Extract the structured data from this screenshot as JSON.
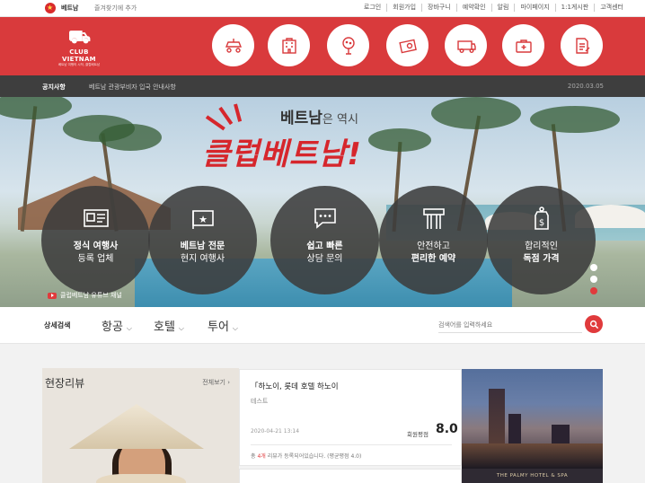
{
  "topbar": {
    "country": "베트남",
    "bookmark": "즐겨찾기에 추가",
    "links": [
      "로그인",
      "회원가입",
      "장바구니",
      "예약확인",
      "알림",
      "마이페이지",
      "1:1게시판",
      "고객센터"
    ]
  },
  "header": {
    "logo_text": "CLUB VIETNAM",
    "logo_sub": "베트남 여행의 시작, 클럽베트남",
    "category_icons": [
      "golf-cart-icon",
      "hotel-icon",
      "golf-icon",
      "ticket-icon",
      "transport-icon",
      "medical-icon",
      "document-icon"
    ]
  },
  "notice": {
    "label": "공지사항",
    "text": "베트남 관광부비자 입국 안내사항",
    "date": "2020.03.05"
  },
  "hero": {
    "slogan_small_highlight": "베트남",
    "slogan_small_rest": "은 역시",
    "slogan_big": "클럽베트남!",
    "features": [
      {
        "line1": "정식 여행사",
        "line2": "등록 업체",
        "icon": "id-card-icon"
      },
      {
        "line1": "베트남 전문",
        "line2": "현지 여행사",
        "icon": "vietnam-flag-icon"
      },
      {
        "line1": "쉽고 빠른",
        "line2": "상담 문의",
        "icon": "chat-icon"
      },
      {
        "line1": "안전하고",
        "line2": "편리한 예약",
        "icon": "card-icon"
      },
      {
        "line1": "합리적인",
        "line2": "독점 가격",
        "icon": "price-tag-icon"
      }
    ],
    "youtube_label": "클럽베트남 유튜브 채널",
    "slide_count": 3,
    "active_slide": 2
  },
  "search": {
    "label": "상세검색",
    "menus": [
      "항공",
      "호텔",
      "투어"
    ],
    "placeholder": "검색어를 입력하세요"
  },
  "review": {
    "title": "현장리뷰",
    "more": "전체보기",
    "item": {
      "heading": "「하노이, 롯데 호텔 하노이",
      "subtitle": "테스트",
      "date": "2020-04-21 13:14",
      "grade_label": "회원평점",
      "score": "8.0",
      "note_prefix": "총 ",
      "note_count": "4개",
      "note_suffix": " 리뷰가 등록되어있습니다. (평균평점 4.0)"
    },
    "next_hotel": "THE PALMY HOTEL & SPA"
  },
  "colors": {
    "brand_red": "#d93a3c",
    "notice_bg": "#3e3e3e"
  }
}
